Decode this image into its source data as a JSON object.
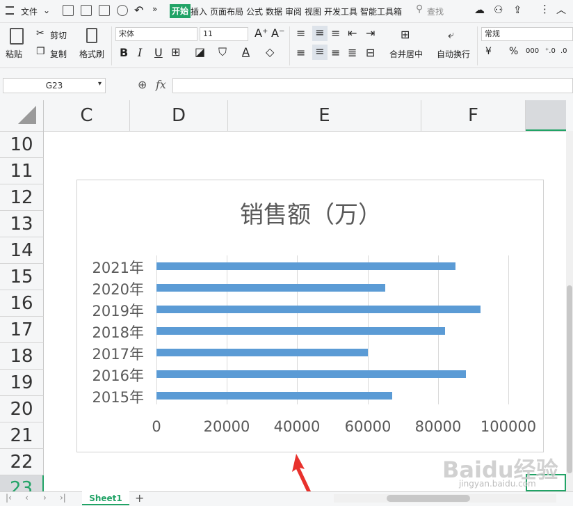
{
  "menu": {
    "file": "文件",
    "tabs": [
      "开始",
      "插入",
      "页面布局",
      "公式",
      "数据",
      "审阅",
      "视图",
      "开发工具",
      "智能工具箱"
    ],
    "search": "查找"
  },
  "ribbon": {
    "paste": "粘贴",
    "cut": "剪切",
    "copy": "复制",
    "format_painter": "格式刷",
    "font_name": "宋体",
    "font_size": "11",
    "bold": "B",
    "italic": "I",
    "underline": "U",
    "merge_center": "合并居中",
    "auto_wrap": "自动换行",
    "number_format": "常规",
    "currency": "¥",
    "percent": "%",
    "thousands": "000"
  },
  "formula_bar": {
    "name_box": "G23",
    "fx": "fx",
    "value": ""
  },
  "columns": [
    "C",
    "D",
    "E",
    "F"
  ],
  "rows": [
    "10",
    "11",
    "12",
    "13",
    "14",
    "15",
    "16",
    "17",
    "18",
    "19",
    "20",
    "21",
    "22",
    "23"
  ],
  "chart_data": {
    "type": "bar",
    "orientation": "horizontal",
    "title": "销售额（万）",
    "categories": [
      "2021年",
      "2020年",
      "2019年",
      "2018年",
      "2017年",
      "2016年",
      "2015年"
    ],
    "values": [
      85000,
      65000,
      92000,
      82000,
      60000,
      88000,
      67000
    ],
    "xlim": [
      0,
      100000
    ],
    "xticks": [
      "0",
      "20000",
      "40000",
      "60000",
      "80000",
      "100000"
    ],
    "color": "#5b9bd5",
    "grid": true,
    "legend": "none"
  },
  "sheets": [
    "Sheet1"
  ],
  "add_sheet": "+",
  "watermark": {
    "main": "Baidu经验",
    "sub": "jingyan.baidu.com"
  },
  "accent": "#21a366"
}
